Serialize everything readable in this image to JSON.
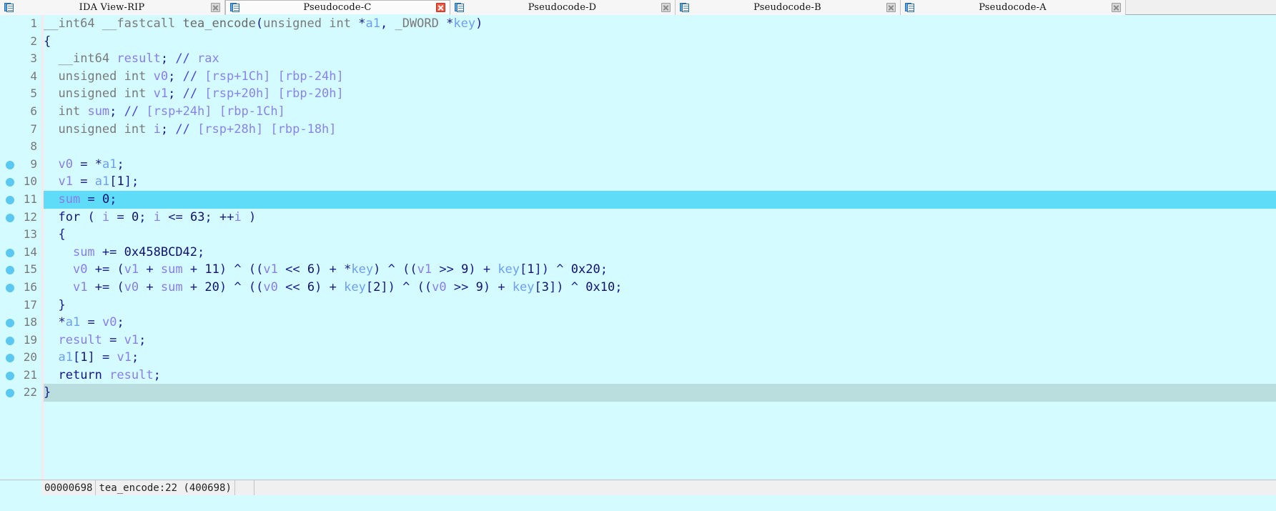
{
  "tabs": [
    {
      "label": "IDA View-RIP",
      "icon": "document-icon",
      "active": false,
      "close": "close-icon-grey"
    },
    {
      "label": "Pseudocode-C",
      "icon": "document-icon",
      "active": true,
      "close": "close-icon-red"
    },
    {
      "label": "Pseudocode-D",
      "icon": "document-icon",
      "active": false,
      "close": "close-icon-grey"
    },
    {
      "label": "Pseudocode-B",
      "icon": "document-icon",
      "active": false,
      "close": "close-icon-grey"
    },
    {
      "label": "Pseudocode-A",
      "icon": "document-icon",
      "active": false,
      "close": "close-icon-grey"
    }
  ],
  "editor": {
    "background_color": "#d4fbff",
    "selection_color": "#5fdcf7",
    "current_line_color": "#b9dedd",
    "breakpoint_color": "#5ac8f0",
    "lines": [
      {
        "n": "1",
        "bp": false,
        "hl": null,
        "text": "__int64 __fastcall tea_encode(unsigned int *a1, _DWORD *key)"
      },
      {
        "n": "2",
        "bp": false,
        "hl": null,
        "text": "{"
      },
      {
        "n": "3",
        "bp": false,
        "hl": null,
        "text": "  __int64 result; // rax"
      },
      {
        "n": "4",
        "bp": false,
        "hl": null,
        "text": "  unsigned int v0; // [rsp+1Ch] [rbp-24h]"
      },
      {
        "n": "5",
        "bp": false,
        "hl": null,
        "text": "  unsigned int v1; // [rsp+20h] [rbp-20h]"
      },
      {
        "n": "6",
        "bp": false,
        "hl": null,
        "text": "  int sum; // [rsp+24h] [rbp-1Ch]"
      },
      {
        "n": "7",
        "bp": false,
        "hl": null,
        "text": "  unsigned int i; // [rsp+28h] [rbp-18h]"
      },
      {
        "n": "8",
        "bp": false,
        "hl": null,
        "text": ""
      },
      {
        "n": "9",
        "bp": true,
        "hl": null,
        "text": "  v0 = *a1;"
      },
      {
        "n": "10",
        "bp": true,
        "hl": null,
        "text": "  v1 = a1[1];"
      },
      {
        "n": "11",
        "bp": true,
        "hl": "sel",
        "text": "  sum = 0;"
      },
      {
        "n": "12",
        "bp": true,
        "hl": null,
        "text": "  for ( i = 0; i <= 63; ++i )"
      },
      {
        "n": "13",
        "bp": false,
        "hl": null,
        "text": "  {"
      },
      {
        "n": "14",
        "bp": true,
        "hl": null,
        "text": "    sum += 0x458BCD42;"
      },
      {
        "n": "15",
        "bp": true,
        "hl": null,
        "text": "    v0 += (v1 + sum + 11) ^ ((v1 << 6) + *key) ^ ((v1 >> 9) + key[1]) ^ 0x20;"
      },
      {
        "n": "16",
        "bp": true,
        "hl": null,
        "text": "    v1 += (v0 + sum + 20) ^ ((v0 << 6) + key[2]) ^ ((v0 >> 9) + key[3]) ^ 0x10;"
      },
      {
        "n": "17",
        "bp": false,
        "hl": null,
        "text": "  }"
      },
      {
        "n": "18",
        "bp": true,
        "hl": null,
        "text": "  *a1 = v0;"
      },
      {
        "n": "19",
        "bp": true,
        "hl": null,
        "text": "  result = v1;"
      },
      {
        "n": "20",
        "bp": true,
        "hl": null,
        "text": "  a1[1] = v1;"
      },
      {
        "n": "21",
        "bp": true,
        "hl": null,
        "text": "  return result;"
      },
      {
        "n": "22",
        "bp": true,
        "hl": "cur",
        "text": "}"
      }
    ]
  },
  "statusbar": {
    "address": "00000698",
    "location": "tea_encode:22 (400698)"
  }
}
